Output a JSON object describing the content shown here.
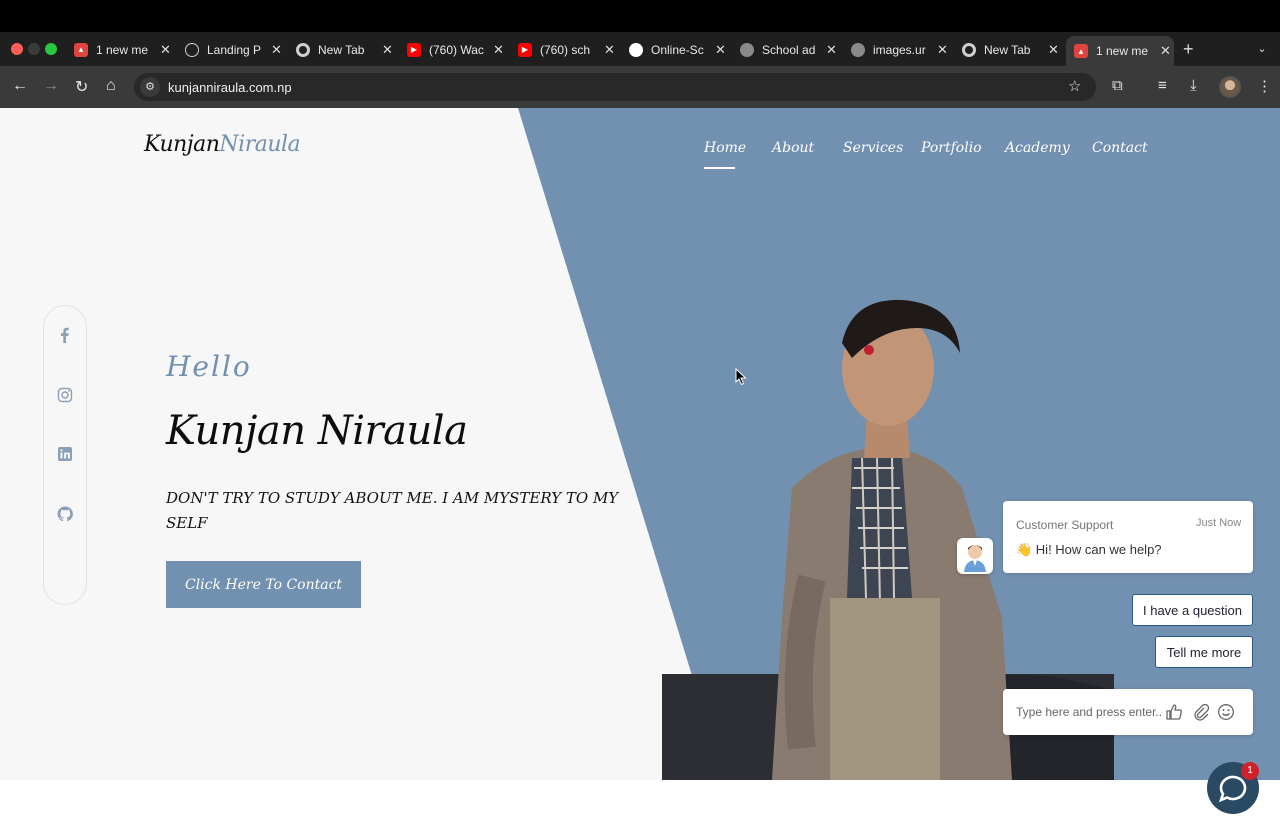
{
  "browser": {
    "tabs": [
      {
        "label": "1 new me",
        "favicon": "pdf-red-icon",
        "color": "#e0443e"
      },
      {
        "label": "Landing P",
        "favicon": "openai-icon",
        "color": "#cfcfcf"
      },
      {
        "label": "New Tab",
        "favicon": "chrome-icon",
        "color": "#cfcfcf"
      },
      {
        "label": "(760) Wac",
        "favicon": "youtube-icon",
        "color": "#ff0000"
      },
      {
        "label": "(760) sch",
        "favicon": "youtube-icon",
        "color": "#ff0000"
      },
      {
        "label": "Online-Sc",
        "favicon": "github-icon",
        "color": "#ffffff"
      },
      {
        "label": "School ad",
        "favicon": "globe-icon",
        "color": "#9a9a9a"
      },
      {
        "label": "images.ur",
        "favicon": "globe-icon",
        "color": "#9a9a9a"
      },
      {
        "label": "New Tab",
        "favicon": "chrome-icon",
        "color": "#cfcfcf"
      },
      {
        "label": "1 new me",
        "favicon": "pdf-red-icon",
        "color": "#e0443e",
        "active": true
      }
    ],
    "url": "kunjanniraula.com.np"
  },
  "site": {
    "logo_first": "Kunjan",
    "logo_second": "Niraula",
    "nav": [
      "Home",
      "About",
      "Services",
      "Portfolio",
      "Academy",
      "Contact"
    ],
    "hello": "Hello",
    "name": "Kunjan Niraula",
    "tagline": "DON'T TRY TO STUDY ABOUT ME. I AM MYSTERY TO MY SELF",
    "cta": "Click Here To Contact",
    "accent_color": "#7290b0",
    "social": [
      "facebook-icon",
      "instagram-icon",
      "linkedin-icon",
      "github-icon"
    ]
  },
  "chat": {
    "agent": "Customer Support",
    "time": "Just Now",
    "message": "👋 Hi! How can we help?",
    "quick_replies": [
      "I have a question",
      "Tell me more"
    ],
    "input_placeholder": "Type here and press enter..",
    "badge": "1"
  }
}
